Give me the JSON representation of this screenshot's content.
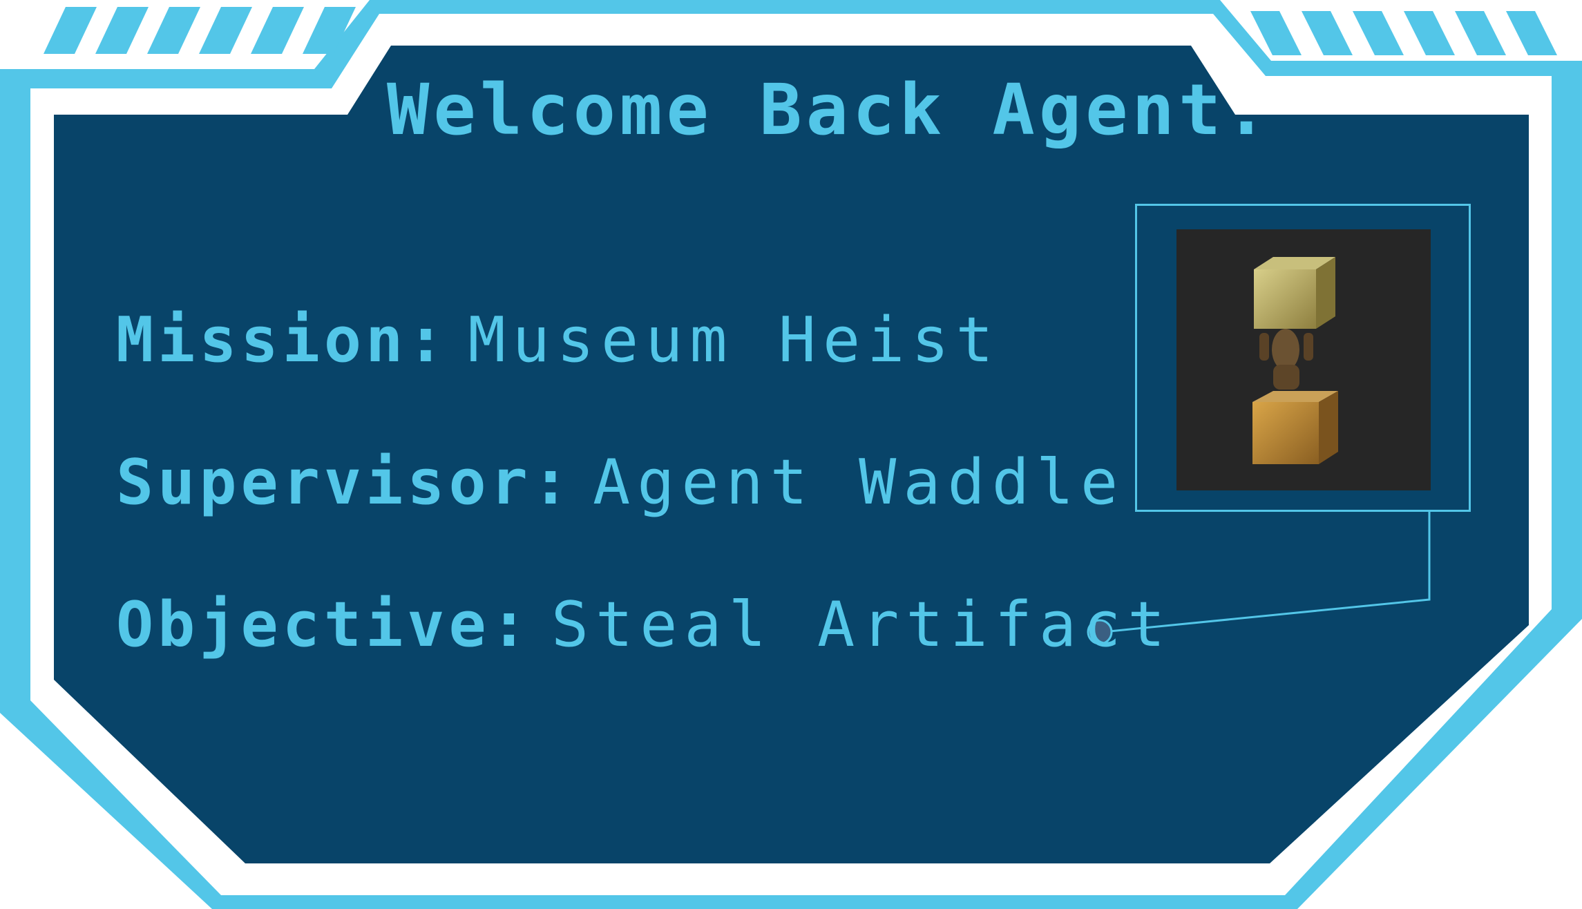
{
  "header": {
    "title": "Welcome Back Agent."
  },
  "briefing": {
    "mission": {
      "label": "Mission:",
      "value": "Museum Heist"
    },
    "supervisor": {
      "label": "Supervisor:",
      "value": "Agent Waddle"
    },
    "objective": {
      "label": "Objective:",
      "value": "Steal Artifact"
    }
  },
  "artifact": {
    "icon": "statue-holding-cubes-icon"
  },
  "colors": {
    "accent": "#53c6e8",
    "panel": "#084469",
    "border_white": "#ffffff",
    "photo_bg": "#262626",
    "connector_dot": "#3a5f82"
  }
}
